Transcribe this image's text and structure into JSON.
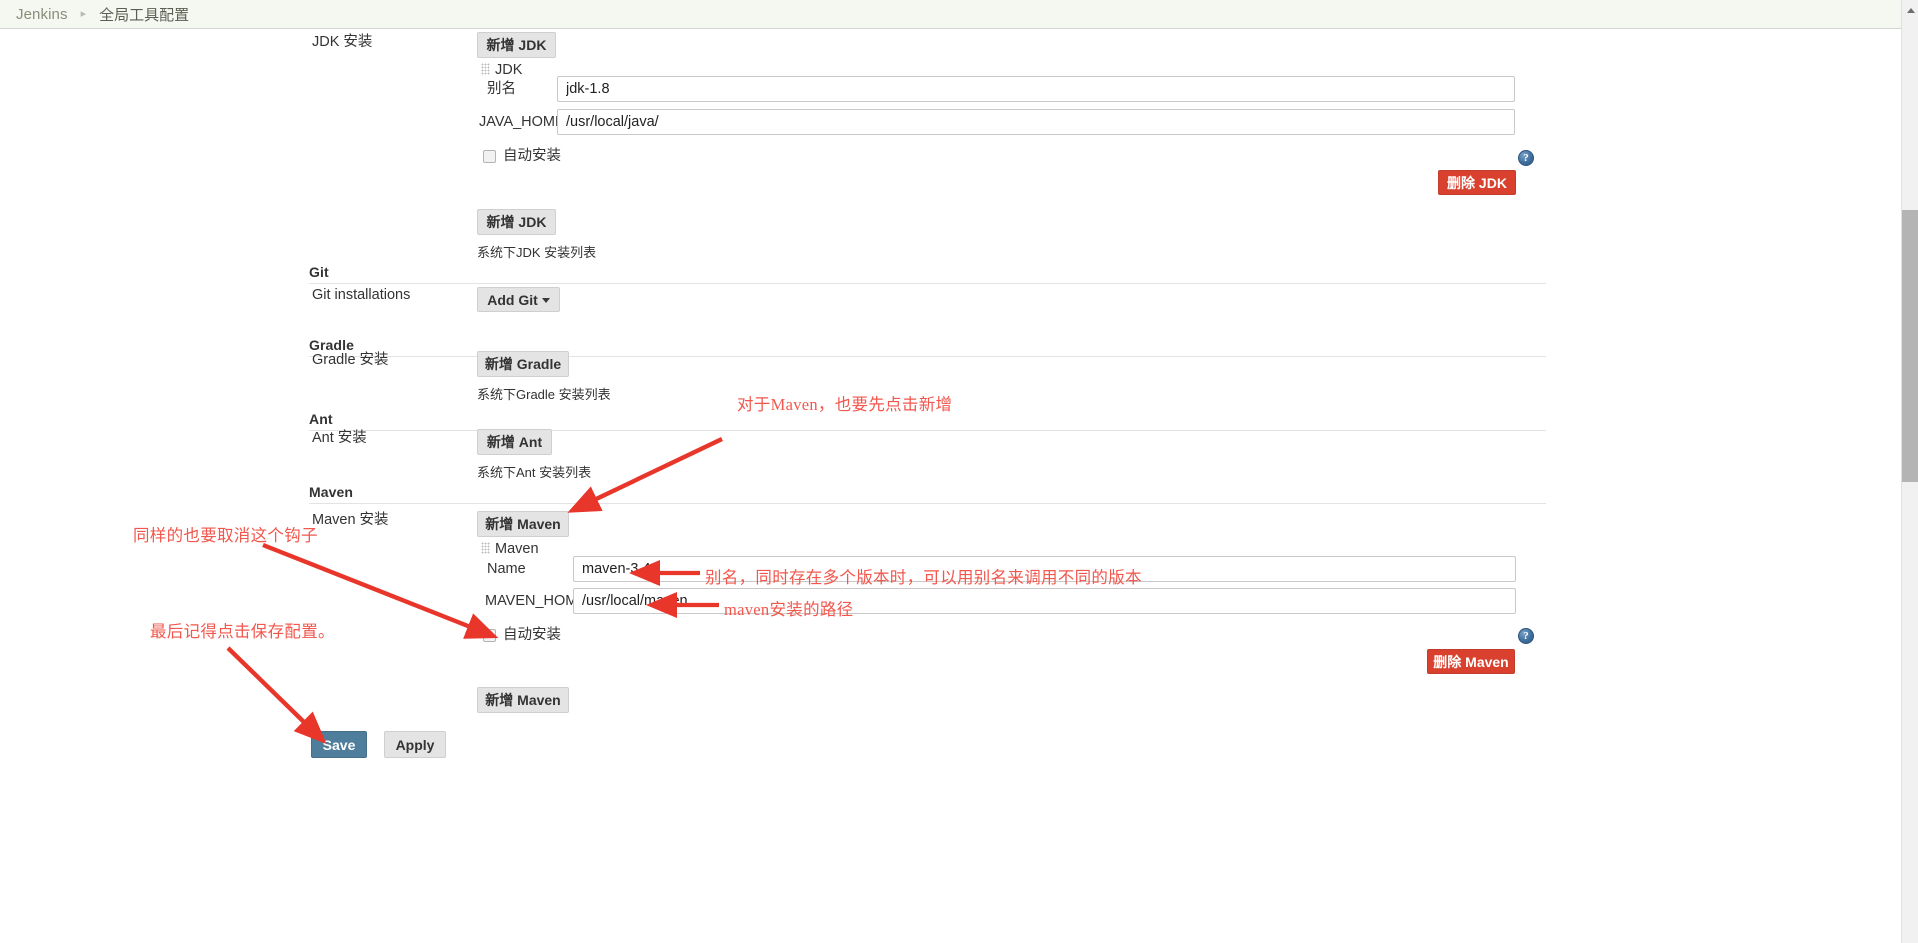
{
  "breadcrumb": {
    "root": "Jenkins",
    "separator": "▸",
    "current": "全局工具配置"
  },
  "jdk_section": {
    "row_label": "JDK 安装",
    "add_button_top": "新增 JDK",
    "entry_title": "JDK",
    "alias_label": "别名",
    "alias_value": "jdk-1.8",
    "java_home_label": "JAVA_HOME",
    "java_home_value": "/usr/local/java/",
    "auto_install_label": "自动安装",
    "auto_install_checked": false,
    "delete_button": "删除 JDK",
    "add_button_bottom": "新增 JDK",
    "hint": "系统下JDK 安装列表",
    "help_glyph": "?"
  },
  "git_section": {
    "title": "Git",
    "row_label": "Git installations",
    "add_button": "Add Git"
  },
  "gradle_section": {
    "title": "Gradle",
    "row_label": "Gradle 安装",
    "add_button": "新增 Gradle",
    "hint": "系统下Gradle 安装列表"
  },
  "ant_section": {
    "title": "Ant",
    "row_label": "Ant 安装",
    "add_button": "新增 Ant",
    "hint": "系统下Ant 安装列表"
  },
  "maven_section": {
    "title": "Maven",
    "row_label": "Maven 安装",
    "add_button_top": "新增 Maven",
    "entry_title": "Maven",
    "name_label": "Name",
    "name_value": "maven-3.4",
    "maven_home_label": "MAVEN_HOME",
    "maven_home_value": "/usr/local/maven",
    "auto_install_label": "自动安装",
    "auto_install_checked": false,
    "delete_button": "删除 Maven",
    "add_button_bottom": "新增 Maven",
    "help_glyph": "?"
  },
  "footer": {
    "save_label": "Save",
    "apply_label": "Apply"
  },
  "annotations": [
    {
      "id": "maven-add-note",
      "text": "对于Maven，也要先点击新增"
    },
    {
      "id": "uncheck-note",
      "text": "同样的也要取消这个钩子"
    },
    {
      "id": "save-note",
      "text": "最后记得点击保存配置。"
    },
    {
      "id": "name-note",
      "text": "别名，同时存在多个版本时，可以用别名来调用不同的版本"
    },
    {
      "id": "home-note",
      "text": "maven安装的路径"
    }
  ],
  "colors": {
    "accent_red": "#f2574d",
    "danger_button": "#d9412e",
    "primary_button": "#4e7e9b",
    "breadcrumb_bg": "#f5f8f1"
  }
}
